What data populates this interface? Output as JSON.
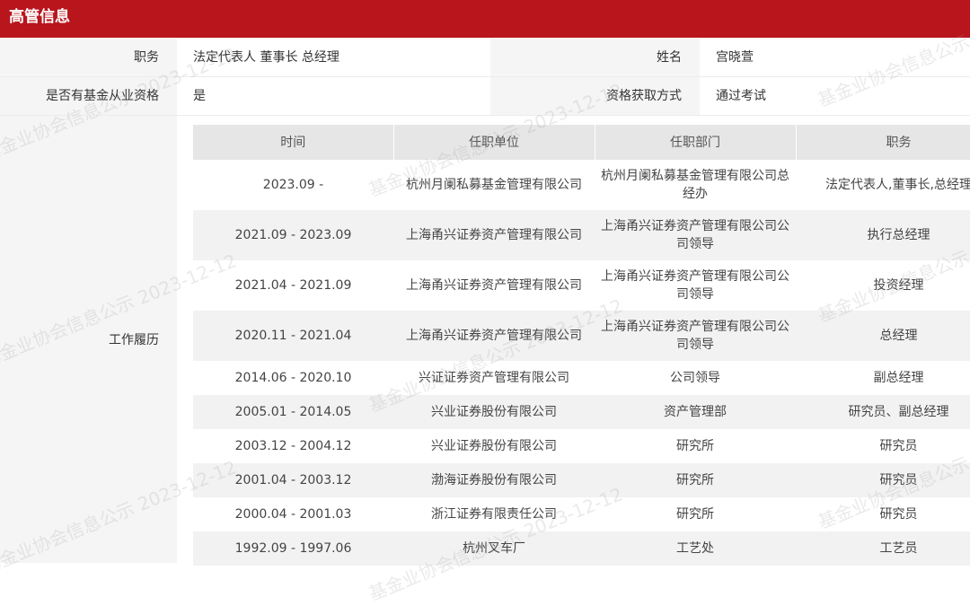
{
  "header": {
    "title": "高管信息"
  },
  "profile": {
    "position_label": "职务",
    "position_value": "法定代表人 董事长 总经理",
    "name_label": "姓名",
    "name_value": "宫晓萱",
    "qualified_label": "是否有基金从业资格",
    "qualified_value": "是",
    "method_label": "资格获取方式",
    "method_value": "通过考试"
  },
  "work_history": {
    "label": "工作履历",
    "columns": [
      "时间",
      "任职单位",
      "任职部门",
      "职务"
    ],
    "rows": [
      [
        "2023.09 -",
        "杭州月阑私募基金管理有限公司",
        "杭州月阑私募基金管理有限公司总经办",
        "法定代表人,董事长,总经理"
      ],
      [
        "2021.09 - 2023.09",
        "上海甬兴证券资产管理有限公司",
        "上海甬兴证券资产管理有限公司公司领导",
        "执行总经理"
      ],
      [
        "2021.04 - 2021.09",
        "上海甬兴证券资产管理有限公司",
        "上海甬兴证券资产管理有限公司公司领导",
        "投资经理"
      ],
      [
        "2020.11 - 2021.04",
        "上海甬兴证券资产管理有限公司",
        "上海甬兴证券资产管理有限公司公司领导",
        "总经理"
      ],
      [
        "2014.06 - 2020.10",
        "兴证证券资产管理有限公司",
        "公司领导",
        "副总经理"
      ],
      [
        "2005.01 - 2014.05",
        "兴业证券股份有限公司",
        "资产管理部",
        "研究员、副总经理"
      ],
      [
        "2003.12 - 2004.12",
        "兴业证券股份有限公司",
        "研究所",
        "研究员"
      ],
      [
        "2001.04 - 2003.12",
        "渤海证券股份有限公司",
        "研究所",
        "研究员"
      ],
      [
        "2000.04 - 2001.03",
        "浙江证券有限责任公司",
        "研究所",
        "研究员"
      ],
      [
        "1992.09 - 1997.06",
        "杭州叉车厂",
        "工艺处",
        "工艺员"
      ]
    ]
  },
  "watermark": {
    "text": "基金业协会信息公示 2023-12-12"
  }
}
